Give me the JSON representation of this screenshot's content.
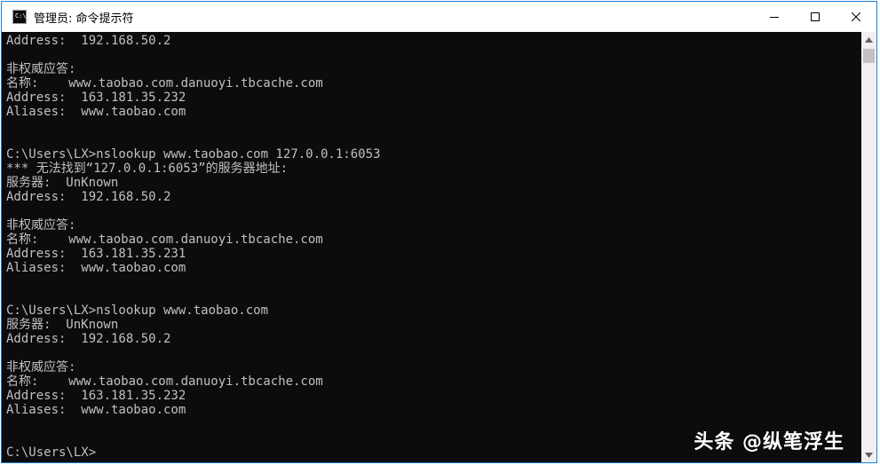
{
  "window": {
    "title": "管理员: 命令提示符",
    "icon_text": "C:\\"
  },
  "controls": {
    "minimize": "minimize",
    "maximize": "maximize",
    "close": "close"
  },
  "console": {
    "lines": [
      "Address:  192.168.50.2",
      "",
      "非权威应答:",
      "名称:    www.taobao.com.danuoyi.tbcache.com",
      "Address:  163.181.35.232",
      "Aliases:  www.taobao.com",
      "",
      "",
      "C:\\Users\\LX>nslookup www.taobao.com 127.0.0.1:6053",
      "*** 无法找到“127.0.0.1:6053”的服务器地址:",
      "服务器:  UnKnown",
      "Address:  192.168.50.2",
      "",
      "非权威应答:",
      "名称:    www.taobao.com.danuoyi.tbcache.com",
      "Address:  163.181.35.231",
      "Aliases:  www.taobao.com",
      "",
      "",
      "C:\\Users\\LX>nslookup www.taobao.com",
      "服务器:  UnKnown",
      "Address:  192.168.50.2",
      "",
      "非权威应答:",
      "名称:    www.taobao.com.danuoyi.tbcache.com",
      "Address:  163.181.35.232",
      "Aliases:  www.taobao.com",
      "",
      "",
      "C:\\Users\\LX>"
    ]
  },
  "watermark": "头条 @纵笔浮生",
  "colors": {
    "console_bg": "#0c0c0c",
    "console_text": "#c0c0c0",
    "window_border": "#1b7fd6"
  }
}
